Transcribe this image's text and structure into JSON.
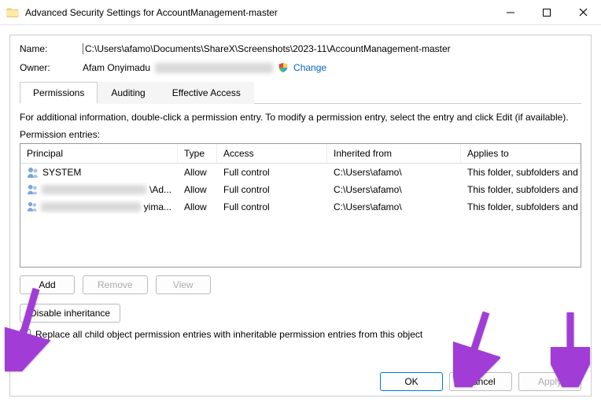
{
  "window": {
    "title": "Advanced Security Settings for AccountManagement-master"
  },
  "fields": {
    "name_label": "Name:",
    "name_value": "C:\\Users\\afamo\\Documents\\ShareX\\Screenshots\\2023-11\\AccountManagement-master",
    "owner_label": "Owner:",
    "owner_value": "Afam Onyimadu",
    "change_link": "Change"
  },
  "tabs": {
    "permissions": "Permissions",
    "auditing": "Auditing",
    "effective": "Effective Access"
  },
  "info": "For additional information, double-click a permission entry. To modify a permission entry, select the entry and click Edit (if available).",
  "entries_label": "Permission entries:",
  "columns": {
    "principal": "Principal",
    "type": "Type",
    "access": "Access",
    "inherited": "Inherited from",
    "applies": "Applies to"
  },
  "rows": [
    {
      "principal": "SYSTEM",
      "type": "Allow",
      "access": "Full control",
      "inherited": "C:\\Users\\afamo\\",
      "applies": "This folder, subfolders and files",
      "blurwidth": 0
    },
    {
      "principal": "\\Ad...",
      "type": "Allow",
      "access": "Full control",
      "inherited": "C:\\Users\\afamo\\",
      "applies": "This folder, subfolders and files",
      "blurwidth": 140
    },
    {
      "principal": "yima...",
      "type": "Allow",
      "access": "Full control",
      "inherited": "C:\\Users\\afamo\\",
      "applies": "This folder, subfolders and files",
      "blurwidth": 140
    }
  ],
  "buttons": {
    "add": "Add",
    "remove": "Remove",
    "view": "View",
    "disable_inh": "Disable inheritance",
    "ok": "OK",
    "cancel": "Cancel",
    "apply": "Apply"
  },
  "checkbox_label": "Replace all child object permission entries with inheritable permission entries from this object"
}
